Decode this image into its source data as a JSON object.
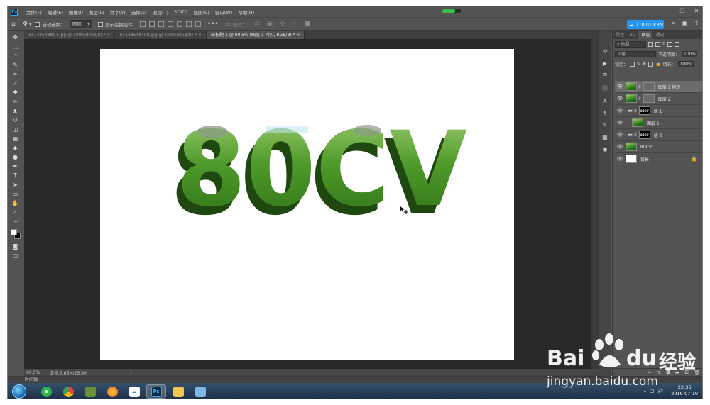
{
  "app": {
    "logo": "Ps"
  },
  "menu": [
    "文件(F)",
    "编辑(E)",
    "图像(I)",
    "图层(L)",
    "文字(Y)",
    "选择(S)",
    "滤镜(T)",
    "3D(D)",
    "视图(V)",
    "窗口(W)",
    "帮助(H)"
  ],
  "options": {
    "auto_select_label": "自动选择：",
    "auto_select_value": "图层",
    "show_transform_label": "显示变换控件",
    "mode_3d_label": "3D 模式：",
    "speed": "0.01 KB/s"
  },
  "tabs": [
    {
      "label": "31143548807.jpg @ 100%(RGB/8) *",
      "active": false
    },
    {
      "label": "64143548458.jpg @ 100%(RGB/8) *",
      "active": false
    },
    {
      "label": "未标题-1 @ 60.5% (图层 1 拷贝, RGB/8) *",
      "active": true
    }
  ],
  "canvas": {
    "artwork_text": "80CV"
  },
  "status": {
    "zoom": "60.5%",
    "doc_size": "文档:7.66M/25.9M",
    "chevron": "〉"
  },
  "timeline_label": "时间轴",
  "panel": {
    "tabs": [
      "属性",
      "3D",
      "图层",
      "通道"
    ],
    "active_tab": "图层",
    "filter_kind": "类型",
    "blend_mode": "正常",
    "opacity_label": "不透明度：",
    "opacity_value": "100%",
    "lock_label": "锁定：",
    "fill_label": "填充：",
    "fill_value": "100%"
  },
  "layers": [
    {
      "name": "图层 1 拷贝",
      "thumb": "grass",
      "mask": true,
      "selected": true,
      "indent": false
    },
    {
      "name": "图层 2",
      "thumb": "grass",
      "mask": true,
      "selected": false,
      "indent": false
    },
    {
      "name": "组 1",
      "thumb": "black",
      "group": true,
      "selected": false,
      "indent": false
    },
    {
      "name": "图层 1",
      "thumb": "grass",
      "mask": false,
      "selected": false,
      "indent": true
    },
    {
      "name": "组 2",
      "thumb": "black",
      "group": true,
      "selected": false,
      "indent": false
    },
    {
      "name": "80CV",
      "thumb": "grass",
      "mask": false,
      "selected": false,
      "indent": false
    },
    {
      "name": "背景",
      "thumb": "white",
      "mask": false,
      "locked": true,
      "selected": false,
      "indent": false
    }
  ],
  "group_thumb_text": "80CV",
  "taskbar": {
    "time": "22:36",
    "date": "2019-07-19"
  },
  "watermark": {
    "brand": "Bai",
    "brand2": "du",
    "cn": "经验",
    "url": "jingyan.baidu.com"
  },
  "colors": {
    "grass": "#3f8f22",
    "accent": "#2196f3",
    "ps_blue": "#31a8ff"
  }
}
